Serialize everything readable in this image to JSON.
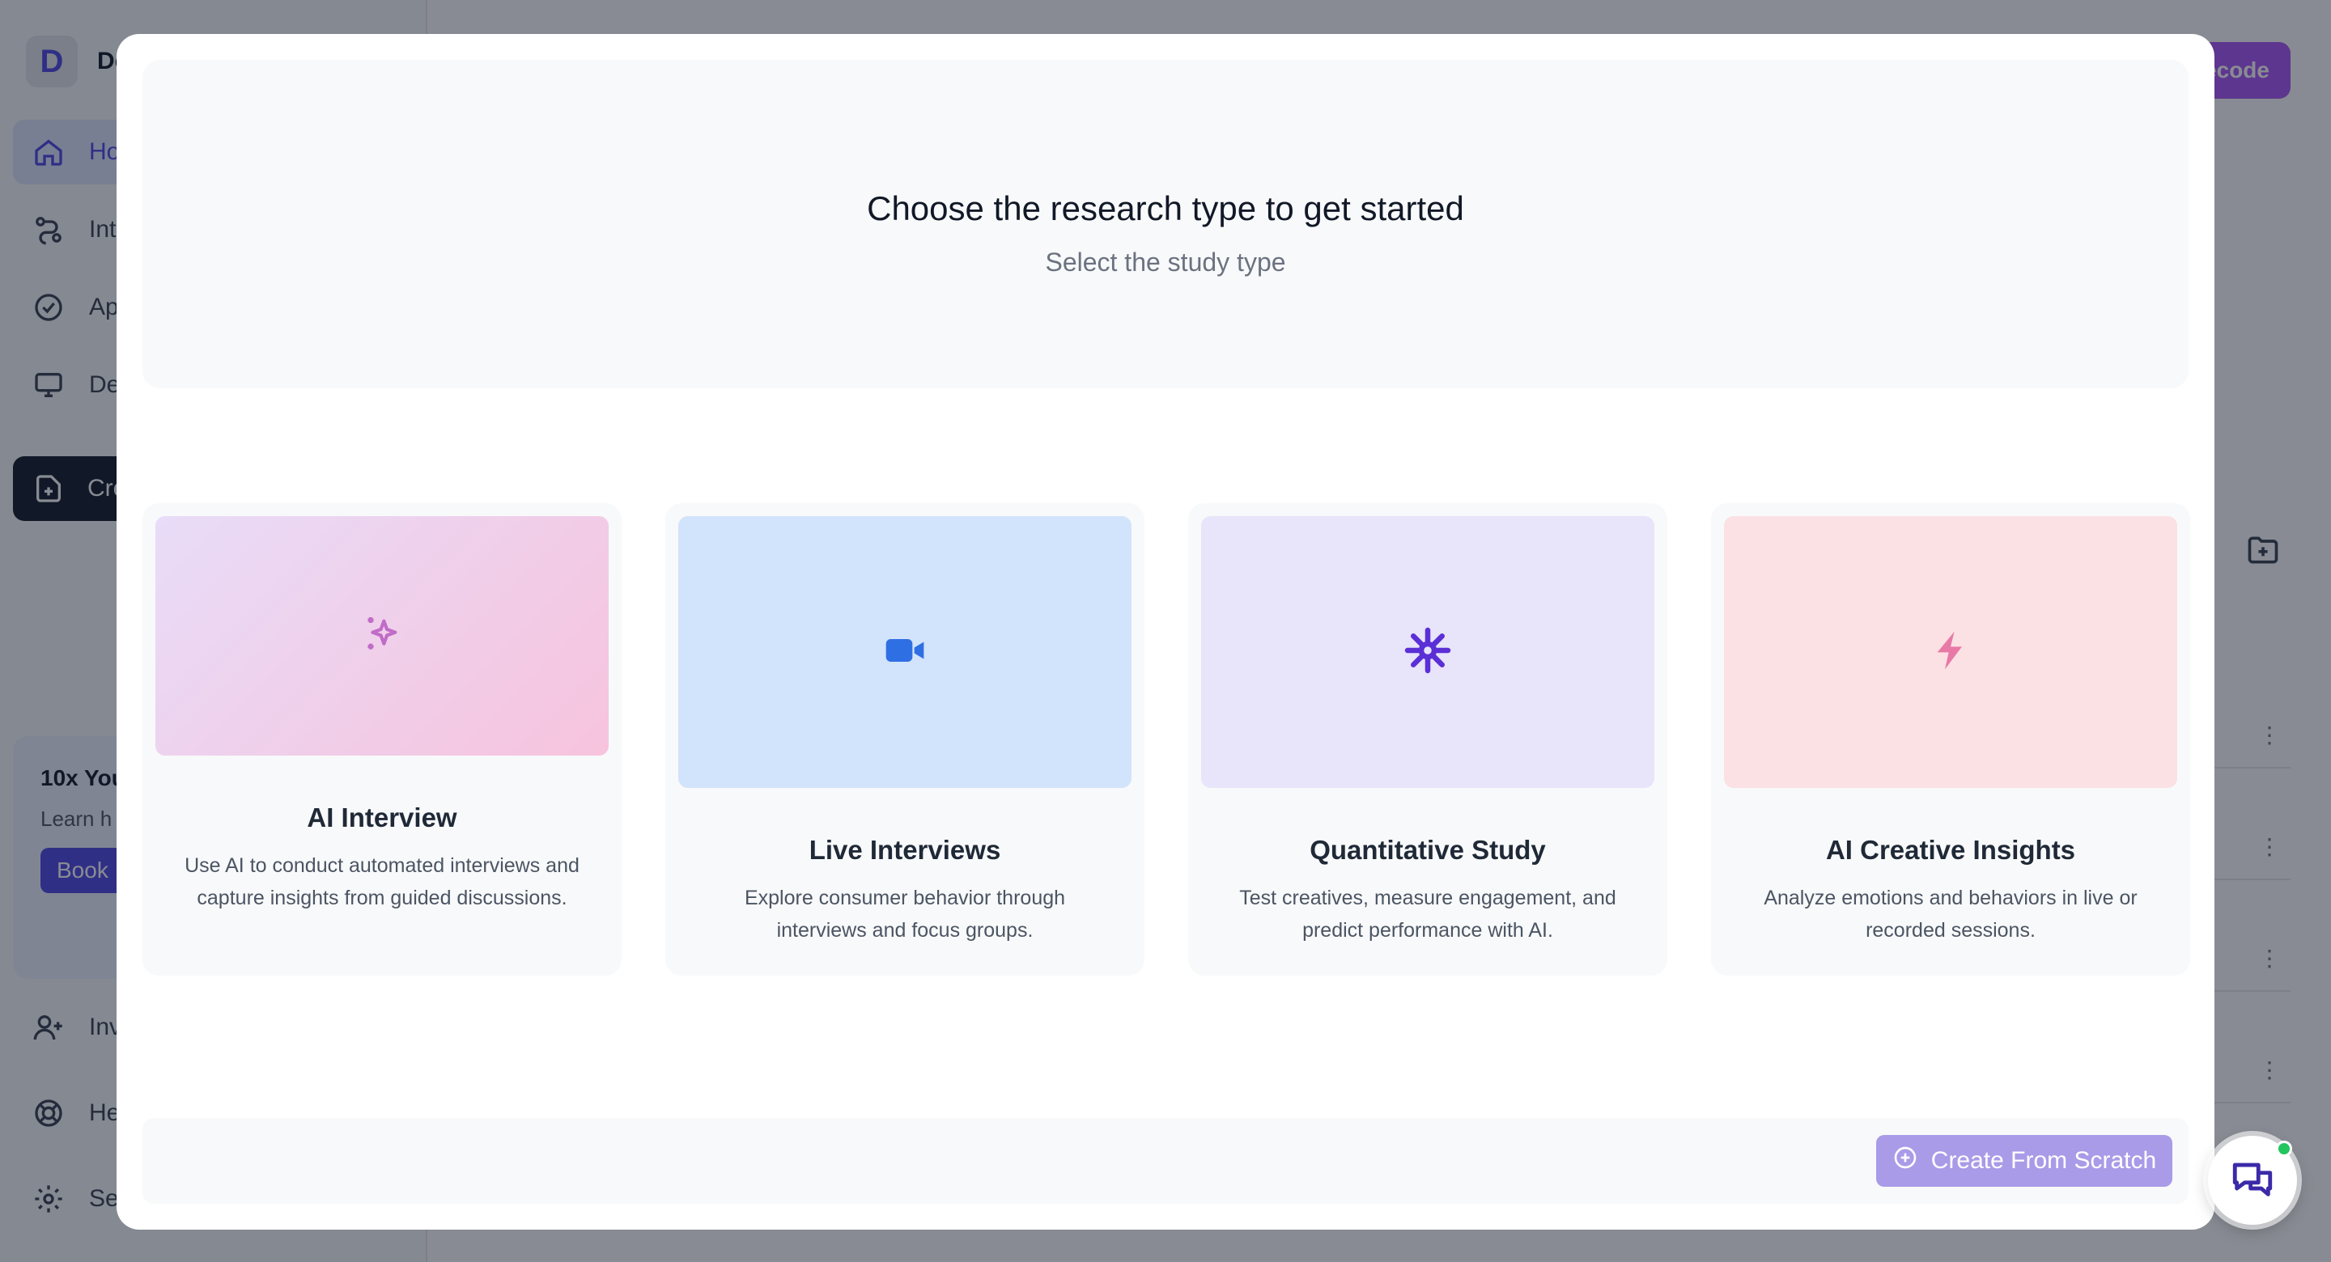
{
  "app": {
    "brand_initial": "D",
    "brand_name": "De",
    "nav": [
      {
        "label": "Home",
        "icon": "home-icon"
      },
      {
        "label": "Integrations",
        "icon": "integrations-icon"
      },
      {
        "label": "Approvals",
        "icon": "check-circle-icon"
      },
      {
        "label": "Demo",
        "icon": "monitor-icon"
      }
    ],
    "create_label": "Create",
    "promo": {
      "title": "10x You",
      "text": "Learn h uncover needle",
      "button": "Book"
    },
    "bottom_nav": [
      {
        "label": "Invite",
        "icon": "user-plus-icon"
      },
      {
        "label": "Help",
        "icon": "lifebuoy-icon"
      },
      {
        "label": "Settings",
        "icon": "gear-icon"
      }
    ],
    "top_button_label": "ecode"
  },
  "modal": {
    "title": "Choose the research type to get started",
    "subtitle": "Select the study type",
    "cards": [
      {
        "title": "AI Interview",
        "description": "Use AI to conduct automated interviews and capture insights from guided discussions.",
        "icon": "sparkles-icon"
      },
      {
        "title": "Live Interviews",
        "description": "Explore consumer behavior through interviews and focus groups.",
        "icon": "video-icon"
      },
      {
        "title": "Quantitative Study",
        "description": "Test creatives, measure engagement, and predict performance with AI.",
        "icon": "asterisk-icon"
      },
      {
        "title": "AI Creative Insights",
        "description": "Analyze emotions and behaviors in live or recorded sessions.",
        "icon": "lightning-icon"
      }
    ],
    "create_from_scratch": "Create From Scratch"
  },
  "colors": {
    "accent": "#4f46e5",
    "overlay": "#111827",
    "button_disabled": "#a99be8",
    "card1_gradient_start": "#e8dcf8",
    "card1_gradient_end": "#f7c3dd",
    "card2_bg": "#d2e3fc",
    "card3_bg": "#e8e4fa",
    "card4_bg": "#fbe1e4",
    "status_online": "#22c55e"
  }
}
